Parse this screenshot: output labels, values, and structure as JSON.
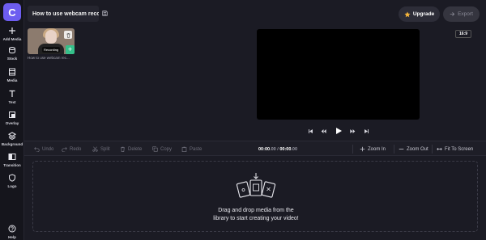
{
  "app": {
    "project_title": "How to use webcam recor",
    "logo_letter": "C",
    "upgrade_label": "Upgrade",
    "export_label": "Export",
    "accent_color": "#6d5df0"
  },
  "sidebar": {
    "items": [
      {
        "label": "Add Media",
        "icon": "plus-icon"
      },
      {
        "label": "Stock",
        "icon": "stack-icon"
      },
      {
        "label": "Media",
        "icon": "film-icon"
      },
      {
        "label": "Text",
        "icon": "text-icon"
      },
      {
        "label": "Overlay",
        "icon": "overlay-icon"
      },
      {
        "label": "Background",
        "icon": "layers-icon"
      },
      {
        "label": "Transition",
        "icon": "transition-icon"
      },
      {
        "label": "Logo",
        "icon": "shield-icon"
      }
    ],
    "help_label": "Help"
  },
  "media": {
    "caption": "How to use webcam rec...",
    "badge": "Recording"
  },
  "preview": {
    "aspect_ratio": "16:9"
  },
  "toolbar": {
    "undo": "Undo",
    "redo": "Redo",
    "split": "Split",
    "delete": "Delete",
    "copy": "Copy",
    "paste": "Paste",
    "current_time": "00:00",
    "current_time_frac": ".00",
    "separator": " / ",
    "total_time": "00:00",
    "total_time_frac": ".00",
    "zoom_in": "Zoom In",
    "zoom_out": "Zoom Out",
    "fit": "Fit To Screen"
  },
  "timeline": {
    "drop_line1": "Drag and drop media from the",
    "drop_line2": "library to start creating your video!"
  }
}
